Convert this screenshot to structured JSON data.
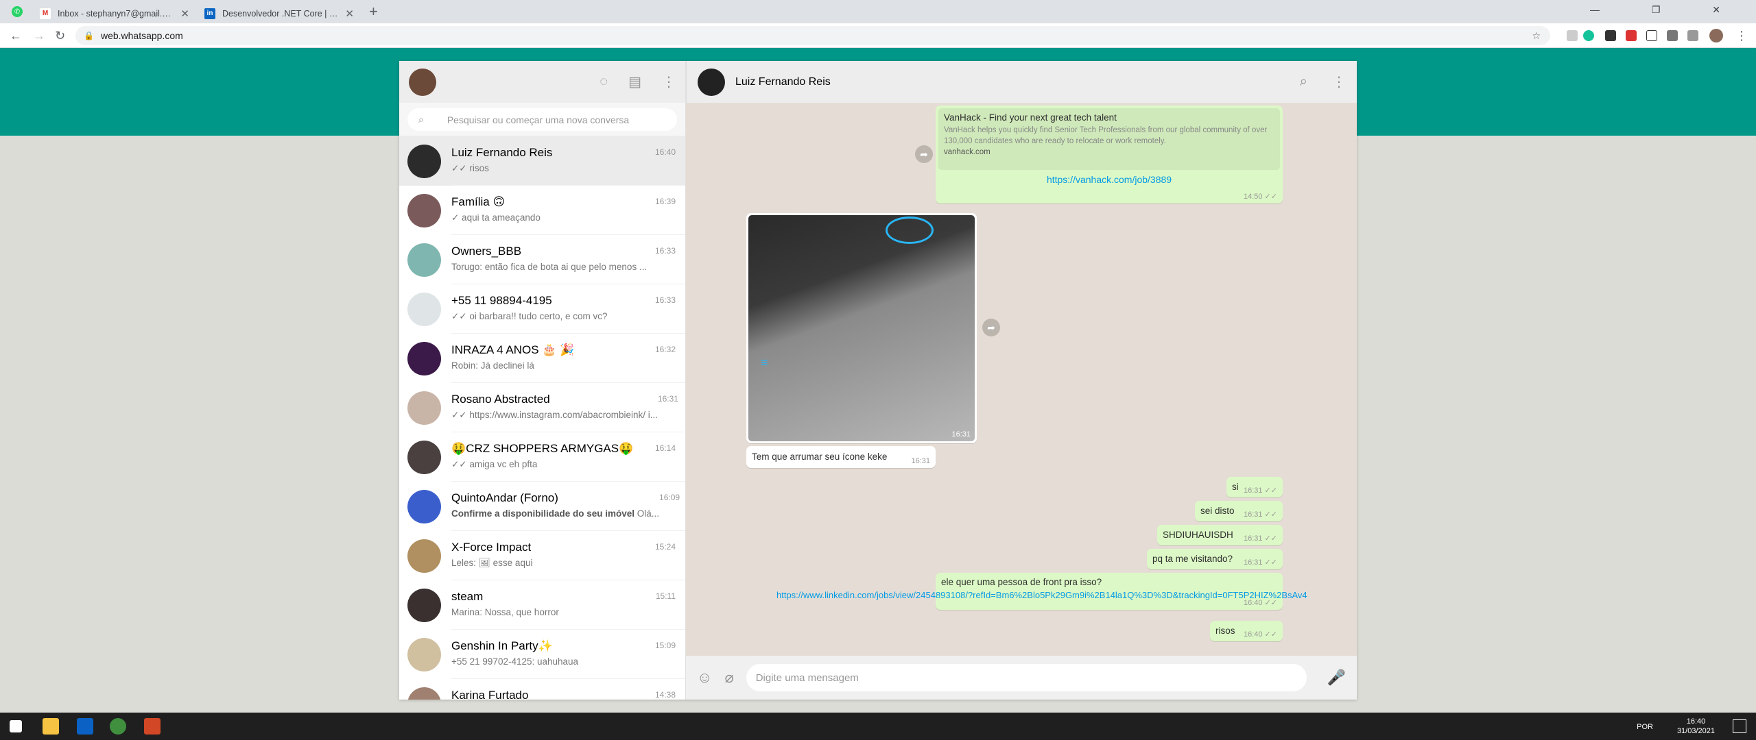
{
  "browser": {
    "tabs": [
      {
        "label": "Inbox - stephanyn7@gmail.com"
      },
      {
        "label": "Desenvolvedor .NET Core | Wass..."
      }
    ],
    "new_tab": "+",
    "url": "web.whatsapp.com"
  },
  "sidebar": {
    "search_placeholder": "Pesquisar ou começar uma nova conversa",
    "chats": [
      {
        "name": "Luiz Fernando Reis",
        "time": "16:40",
        "preview": "✓✓ risos",
        "color": "#2b2b2b"
      },
      {
        "name": "Família 🙃",
        "time": "16:39",
        "preview": "✓ aqui ta ameaçando",
        "color": "#7a5a5a"
      },
      {
        "name": "Owners_BBB",
        "time": "16:33",
        "preview": "Torugo: então fica de bota ai que pelo menos ...",
        "color": "#7fb6b0"
      },
      {
        "name": "+55 11 98894-4195",
        "time": "16:33",
        "preview": "✓✓ oi barbara!! tudo certo, e com vc?",
        "color": "#dfe5e7"
      },
      {
        "name": "INRAZA 4 ANOS 🎂 🎉",
        "time": "16:32",
        "preview": "Robin: Já declinei lá",
        "color": "#3b1a4a"
      },
      {
        "name": "Rosano Abstracted",
        "time": "16:31",
        "preview": "✓✓ https://www.instagram.com/abacrombieink/ i...",
        "color": "#c9b5a8"
      },
      {
        "name": "🤑CRZ SHOPPERS ARMYGAS🤑",
        "time": "16:14",
        "preview": "✓✓ amiga vc eh pfta",
        "color": "#4a4040"
      },
      {
        "name": "QuintoAndar (Forno)",
        "time": "16:09",
        "preview_bold": "Confirme a disponibilidade do seu imóvel",
        "preview": " Olá...",
        "color": "#3a5fcd"
      },
      {
        "name": "X-Force Impact",
        "time": "15:24",
        "preview": "Leles: 🖼 esse aqui",
        "color": "#b09060"
      },
      {
        "name": "steam",
        "time": "15:11",
        "preview": "Marina: Nossa, que horror",
        "color": "#3a3030"
      },
      {
        "name": "Genshin In Party✨",
        "time": "15:09",
        "preview": "+55 21 99702-4125: uahuhaua",
        "color": "#d0c0a0"
      },
      {
        "name": "Karina Furtado",
        "time": "14:38",
        "preview": "",
        "color": "#a08070"
      }
    ]
  },
  "conversation": {
    "contact": "Luiz Fernando Reis",
    "link_preview": {
      "title": "VanHack - Find your next great tech talent",
      "desc": "VanHack helps you quickly find Senior Tech Professionals from our global community of over 130,000 candidates who are ready to relocate or work remotely.",
      "domain": "vanhack.com",
      "url": "https://vanhack.com/job/3889",
      "time": "14:50 ✓✓"
    },
    "image_time": "16:31",
    "image_caption": "Tem que arrumar seu ícone keke",
    "image_caption_time": "16:31",
    "outgoing": [
      {
        "text": "si",
        "time": "16:31 ✓✓"
      },
      {
        "text": "sei disto",
        "time": "16:31 ✓✓"
      },
      {
        "text": "SHDIUHAUISDH",
        "time": "16:31 ✓✓"
      },
      {
        "text": "pq ta me visitando?",
        "time": "16:31 ✓✓"
      }
    ],
    "long_msg": {
      "text": "ele quer uma pessoa de front pra isso?",
      "link": "https://www.linkedin.com/jobs/view/2454893108/?refId=Bm6%2Blo5Pk29Gm9i%2B14la1Q%3D%3D&trackingId=0FT5P2HIZ%2BsAv4",
      "time": "16:40 ✓✓"
    },
    "last": {
      "text": "risos",
      "time": "16:40 ✓✓"
    },
    "composer_placeholder": "Digite uma mensagem"
  },
  "taskbar": {
    "lang": "POR",
    "time": "16:40",
    "date": "31/03/2021"
  }
}
